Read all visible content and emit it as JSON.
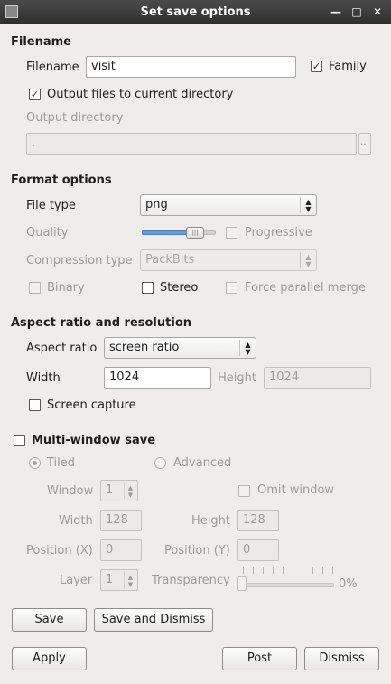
{
  "window": {
    "title": "Set save options"
  },
  "filename_section": {
    "heading": "Filename",
    "filename_label": "Filename",
    "filename_value": "visit",
    "family_label": "Family",
    "family_checked": true,
    "output_current_dir_label": "Output files to current directory",
    "output_current_dir_checked": true,
    "output_directory_label": "Output directory",
    "output_directory_value": ".",
    "browse_label": "..."
  },
  "format_section": {
    "heading": "Format options",
    "file_type_label": "File type",
    "file_type_value": "png",
    "quality_label": "Quality",
    "quality_level": 0.72,
    "progressive_label": "Progressive",
    "compression_label": "Compression type",
    "compression_value": "PackBits",
    "binary_label": "Binary",
    "stereo_label": "Stereo",
    "force_parallel_label": "Force parallel merge"
  },
  "aspect_section": {
    "heading": "Aspect ratio and resolution",
    "aspect_label": "Aspect ratio",
    "aspect_value": "screen ratio",
    "width_label": "Width",
    "width_value": "1024",
    "height_label": "Height",
    "height_value": "1024",
    "screen_capture_label": "Screen capture"
  },
  "multiwindow_section": {
    "heading": "Multi-window save",
    "tiled_label": "Tiled",
    "advanced_label": "Advanced",
    "window_label": "Window",
    "window_value": "1",
    "omit_window_label": "Omit window",
    "width_label": "Width",
    "width_value": "128",
    "height_label": "Height",
    "height_value": "128",
    "posx_label": "Position (X)",
    "posx_value": "0",
    "posy_label": "Position (Y)",
    "posy_value": "0",
    "layer_label": "Layer",
    "layer_value": "1",
    "transparency_label": "Transparency",
    "transparency_value": "0%"
  },
  "buttons": {
    "save": "Save",
    "save_dismiss": "Save and Dismiss",
    "apply": "Apply",
    "post": "Post",
    "dismiss": "Dismiss"
  },
  "icons": {
    "minimize": "minimize-icon",
    "maximize": "maximize-icon",
    "close": "close-icon"
  }
}
